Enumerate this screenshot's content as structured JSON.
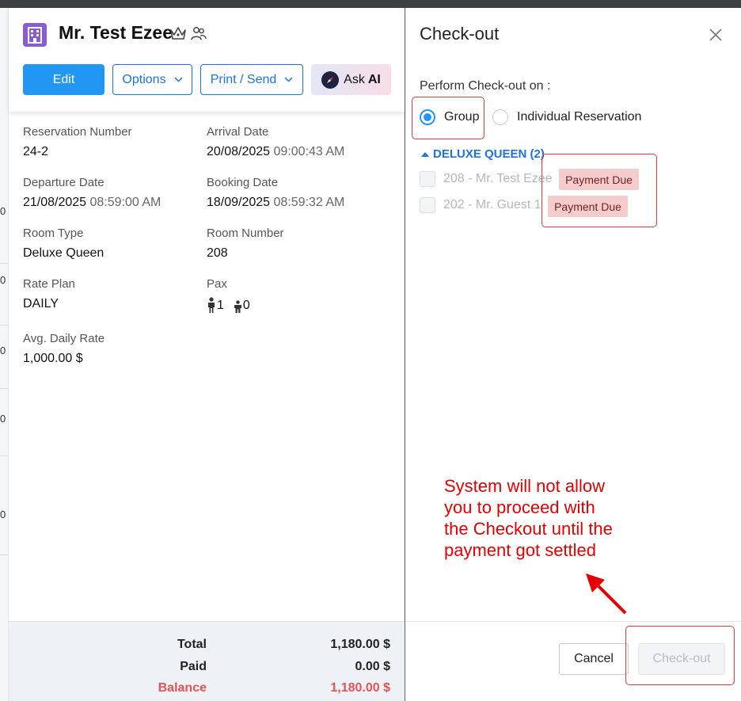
{
  "background": {
    "edge_ticks": [
      "0",
      "0",
      "0",
      "0",
      "0",
      "0"
    ]
  },
  "header": {
    "guest_name": "Mr. Test Ezee",
    "icons": [
      "hotel-building-icon",
      "crown-icon",
      "people-icon"
    ],
    "buttons": {
      "edit": "Edit",
      "options": "Options",
      "print_send": "Print / Send",
      "ask": "Ask",
      "ai": "AI"
    }
  },
  "details": {
    "reservation_number": {
      "label": "Reservation Number",
      "value": "24-2"
    },
    "arrival_date": {
      "label": "Arrival Date",
      "date": "20/08/2025",
      "time": "09:00:43 AM"
    },
    "departure_date": {
      "label": "Departure Date",
      "date": "21/08/2025",
      "time": "08:59:00 AM"
    },
    "booking_date": {
      "label": "Booking Date",
      "date": "18/09/2025",
      "time": "08:59:32 AM"
    },
    "room_type": {
      "label": "Room Type",
      "value": "Deluxe Queen"
    },
    "room_number": {
      "label": "Room Number",
      "value": "208"
    },
    "rate_plan": {
      "label": "Rate Plan",
      "value": "DAILY"
    },
    "pax": {
      "label": "Pax",
      "adults": "1",
      "children": "0"
    },
    "avg_daily_rate": {
      "label": "Avg. Daily Rate",
      "value": "1,000.00 $"
    }
  },
  "totals": {
    "total": {
      "label": "Total",
      "value": "1,180.00 $"
    },
    "paid": {
      "label": "Paid",
      "value": "0.00 $"
    },
    "balance": {
      "label": "Balance",
      "value": "1,180.00 $"
    }
  },
  "checkout": {
    "title": "Check-out",
    "perform_label": "Perform Check-out on :",
    "options": [
      "Group",
      "Individual Reservation"
    ],
    "selected": "Group",
    "group_header": "DELUXE QUEEN (2)",
    "rooms": [
      {
        "label": "208 - Mr. Test Ezee",
        "badge": "Payment Due"
      },
      {
        "label": "202 - Mr. Guest 1",
        "badge": "Payment Due"
      }
    ],
    "annotation": [
      "System will not allow",
      "you to proceed with",
      "the Checkout until the",
      "payment got settled"
    ],
    "cancel_label": "Cancel",
    "checkout_label": "Check-out",
    "colors": {
      "accent": "#2196f3",
      "annotation": "#e60000",
      "badge_bg": "#f4cccc",
      "balance": "#e45454"
    }
  }
}
